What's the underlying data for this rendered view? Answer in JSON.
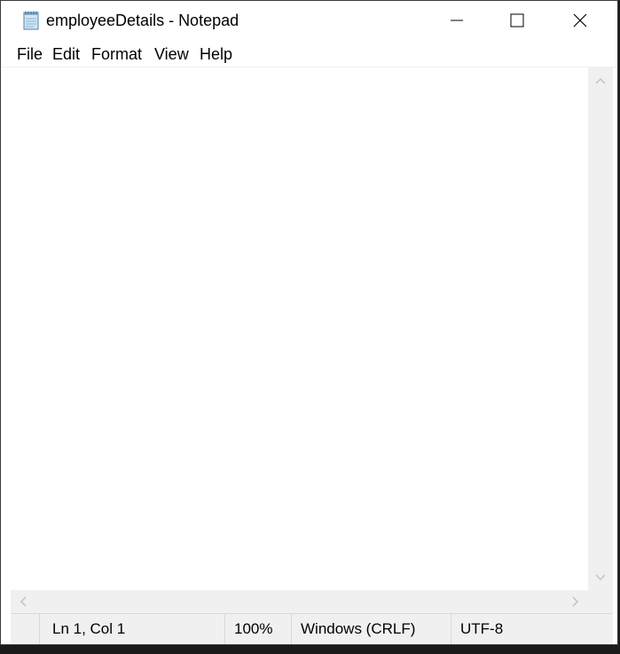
{
  "window": {
    "title": "employeeDetails - Notepad",
    "app_icon": "notepad-icon",
    "controls": {
      "minimize_icon": "minimize-icon",
      "maximize_icon": "maximize-icon",
      "close_icon": "close-icon"
    }
  },
  "menubar": {
    "items": [
      {
        "label": "File"
      },
      {
        "label": "Edit"
      },
      {
        "label": "Format"
      },
      {
        "label": "View"
      },
      {
        "label": "Help"
      }
    ]
  },
  "editor": {
    "content": ""
  },
  "statusbar": {
    "position": "Ln 1, Col 1",
    "zoom": "100%",
    "line_endings": "Windows (CRLF)",
    "encoding": "UTF-8"
  },
  "colors": {
    "window_bg": "#ffffff",
    "chrome_bg": "#f0f0f0",
    "scroll_arrow": "#c2c2c2",
    "divider": "#d9d9d9"
  }
}
